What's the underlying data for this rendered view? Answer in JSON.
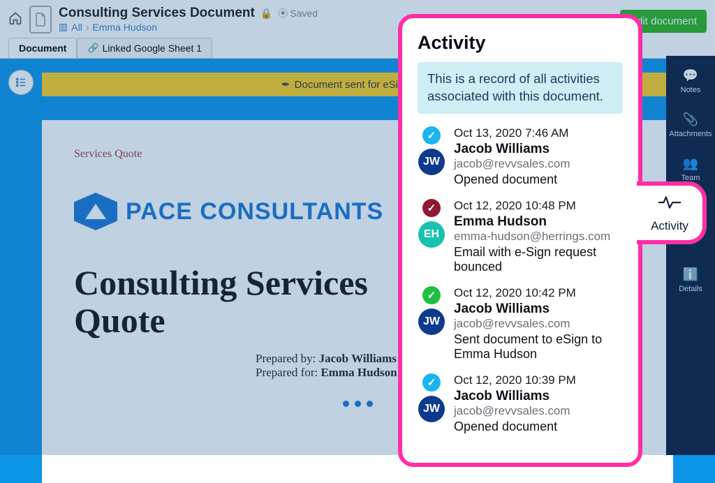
{
  "header": {
    "title": "Consulting Services Document",
    "saved_label": "Saved",
    "breadcrumb_root": "All",
    "breadcrumb_person": "Emma Hudson",
    "edit_button": "Edit document",
    "tab_document": "Document",
    "tab_linked": "Linked Google Sheet 1"
  },
  "banner": {
    "text": "Document sent for eSignature"
  },
  "doc": {
    "kicker": "Services Quote",
    "brand_logo_alt": "PA",
    "brand_name": "PACE CONSULTANTS",
    "big_title_line1": "Consulting Services",
    "big_title_line2": "Quote",
    "prepared_by_label": "Prepared by:",
    "prepared_by_name": "Jacob Williams",
    "prepared_for_label": "Prepared for:",
    "prepared_for_name": "Emma Hudson"
  },
  "rail": {
    "notes": "Notes",
    "attachments": "Attachments",
    "team": "Team",
    "activity": "Activity",
    "details": "Details"
  },
  "activity": {
    "title": "Activity",
    "info": "This is a record of all activities associated with this document.",
    "items": [
      {
        "status_color": "blue",
        "avatar_initials": "JW",
        "avatar_color": "navy",
        "time": "Oct 13, 2020 7:46 AM",
        "name": "Jacob Williams",
        "email": "jacob@revvsales.com",
        "desc": "Opened document"
      },
      {
        "status_color": "maroon",
        "avatar_initials": "EH",
        "avatar_color": "teal",
        "time": "Oct 12, 2020 10:48 PM",
        "name": "Emma Hudson",
        "email": "emma-hudson@herrings.com",
        "desc": "Email with e-Sign request bounced"
      },
      {
        "status_color": "green",
        "avatar_initials": "JW",
        "avatar_color": "navy",
        "time": "Oct 12, 2020 10:42 PM",
        "name": "Jacob Williams",
        "email": "jacob@revvsales.com",
        "desc": "Sent document to eSign to Emma Hudson"
      },
      {
        "status_color": "blue",
        "avatar_initials": "JW",
        "avatar_color": "navy",
        "time": "Oct 12, 2020 10:39 PM",
        "name": "Jacob Williams",
        "email": "jacob@revvsales.com",
        "desc": "Opened document"
      }
    ]
  }
}
